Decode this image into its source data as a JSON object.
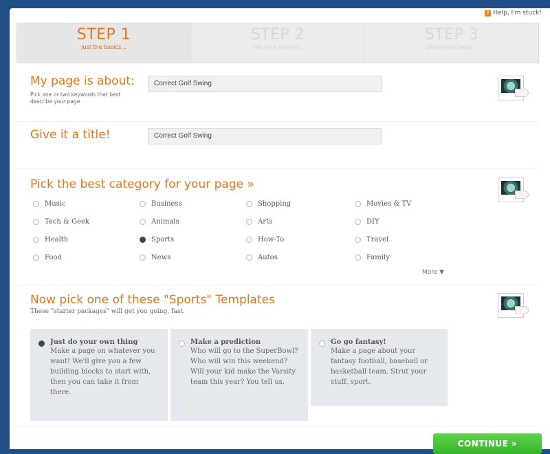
{
  "help": {
    "label": "Help, I'm stuck!"
  },
  "steps": [
    {
      "title": "STEP 1",
      "subtitle": "Just the basics..."
    },
    {
      "title": "STEP 2",
      "subtitle": "Add your content..."
    },
    {
      "title": "STEP 3",
      "subtitle": "Share your page..."
    }
  ],
  "about": {
    "heading": "My page is about:",
    "hint": "Pick one or two keywords that best describe your page",
    "value": "Correct Golf Swing"
  },
  "title_section": {
    "heading": "Give it a title!",
    "value": "Correct Golf Swing"
  },
  "category": {
    "heading": "Pick the best category for your page »",
    "options": [
      "Music",
      "Business",
      "Shopping",
      "Movies & TV",
      "Tech & Geek",
      "Animals",
      "Arts",
      "DIY",
      "Health",
      "Sports",
      "How-To",
      "Travel",
      "Food",
      "News",
      "Autos",
      "Family"
    ],
    "selected": "Sports",
    "more": "More ▼"
  },
  "templates": {
    "heading": "Now pick one of these \"Sports\" Templates",
    "subheading": "These \"starter packages\" will get you going, fast.",
    "items": [
      {
        "title": "Just do your own thing",
        "desc": "Make a page on whatever you want! We'll give you a few building blocks to start with, then you can take it from there.",
        "selected": true
      },
      {
        "title": "Make a prediction",
        "desc": "Who will go to the SuperBowl? Who will win this weekend? Will your kid make the Varsity team this year? You tell us.",
        "selected": false
      },
      {
        "title": "Go go fantasy!",
        "desc": "Make a page about your fantasy football, baseball or basketball team. Strut your stuff, sport.",
        "selected": false
      }
    ]
  },
  "continue_label": "CONTINUE »"
}
